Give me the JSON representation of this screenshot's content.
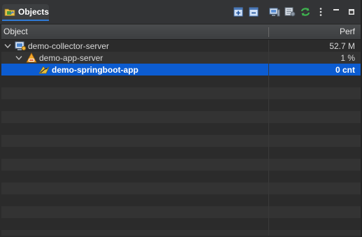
{
  "view": {
    "tab_label": "Objects",
    "toolbar": [
      "expand-all-icon",
      "collapse-all-icon",
      "server-view-icon",
      "config-icon",
      "refresh-icon",
      "view-menu-icon",
      "minimize-icon",
      "maximize-icon"
    ]
  },
  "table": {
    "columns": {
      "object": "Object",
      "perf": "Perf"
    },
    "rows": [
      {
        "name": "demo-collector-server",
        "perf": "52.7 M",
        "icon": "collector-server-icon",
        "expanded": true
      },
      {
        "name": "demo-app-server",
        "perf": "1 %",
        "icon": "app-server-icon",
        "expanded": true
      },
      {
        "name": "demo-springboot-app",
        "perf": "0 cnt",
        "icon": "springboot-app-icon",
        "selected": true
      }
    ]
  },
  "colors": {
    "selection": "#0c5cd1",
    "tab_accent": "#2f7ad6",
    "refresh": "#3fb34f"
  }
}
